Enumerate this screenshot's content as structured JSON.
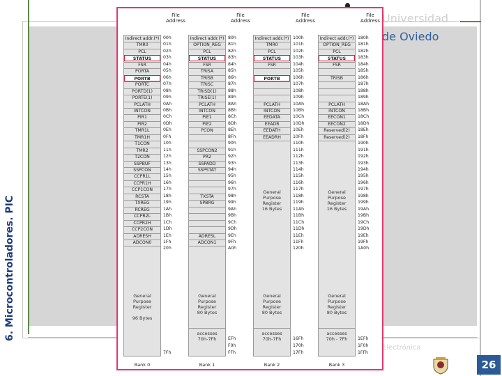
{
  "slide": {
    "side_title": "6. Microcontroladores. PIC",
    "university_line1": "Universidad",
    "university_line2": "de Oviedo",
    "footer_word": "Electrónica",
    "page_number": "26"
  },
  "diagram": {
    "header_label": "File\nAddress",
    "banks": [
      {
        "name": "Bank 0",
        "registers": [
          "Indirect addr.(*)",
          "TMR0",
          "PCL",
          "STATUS",
          "FSR",
          "PORTA",
          "PORTB",
          "PORTC",
          "PORTD(1)",
          "PORTE(1)",
          "PCLATH",
          "INTCON",
          "PIR1",
          "PIR2",
          "TMR1L",
          "TMR1H",
          "T1CON",
          "TMR2",
          "T2CON",
          "SSPBUF",
          "SSPCON",
          "CCPR1L",
          "CCPR1H",
          "CCP1CON",
          "RCSTA",
          "TXREG",
          "RCREG",
          "CCPR2L",
          "CCPR2H",
          "CCP2CON",
          "ADRESH",
          "ADCON0"
        ],
        "addresses": [
          "00h",
          "01h",
          "02h",
          "03h",
          "04h",
          "05h",
          "06h",
          "07h",
          "08h",
          "09h",
          "0Ah",
          "0Bh",
          "0Ch",
          "0Dh",
          "0Eh",
          "0Fh",
          "10h",
          "11h",
          "12h",
          "13h",
          "14h",
          "15h",
          "16h",
          "17h",
          "18h",
          "19h",
          "1Ah",
          "1Bh",
          "1Ch",
          "1Dh",
          "1Eh",
          "1Fh",
          "20h",
          "7Fh"
        ],
        "gp_text": "General\nPurpose\nRegister\n\n96 Bytes",
        "boxed": [
          "STATUS",
          "PORTB"
        ]
      },
      {
        "name": "Bank 1",
        "registers": [
          "Indirect addr.(*)",
          "OPTION_REG",
          "PCL",
          "STATUS",
          "FSR",
          "TRISA",
          "TRISB",
          "TRISC",
          "TRISD(1)",
          "TRISE(1)",
          "PCLATH",
          "INTCON",
          "PIE1",
          "PIE2",
          "PCON",
          "",
          "",
          "SSPCON2",
          "PR2",
          "SSPADD",
          "SSPSTAT",
          "",
          "",
          "",
          "TXSTA",
          "SPBRG",
          "",
          "",
          "",
          "",
          "ADRESL",
          "ADCON1"
        ],
        "addresses": [
          "80h",
          "81h",
          "82h",
          "83h",
          "84h",
          "85h",
          "86h",
          "87h",
          "88h",
          "89h",
          "8Ah",
          "8Bh",
          "8Ch",
          "8Dh",
          "8Eh",
          "8Fh",
          "90h",
          "91h",
          "92h",
          "93h",
          "94h",
          "95h",
          "96h",
          "97h",
          "98h",
          "99h",
          "9Ah",
          "9Bh",
          "9Ch",
          "9Dh",
          "9Eh",
          "9Fh",
          "A0h",
          "EFh",
          "F0h",
          "FFh"
        ],
        "gp_text": "General\nPurpose\nRegister\n80 Bytes",
        "access_text": "accesses\n70h-7Fh",
        "boxed": [
          "STATUS"
        ]
      },
      {
        "name": "Bank 2",
        "registers": [
          "Indirect addr.(*)",
          "TMR0",
          "PCL",
          "STATUS",
          "FSR",
          "",
          "PORTB",
          "",
          "",
          "",
          "PCLATH",
          "INTCON",
          "EEDATA",
          "EEADR",
          "EEDATH",
          "EEADRH"
        ],
        "addresses": [
          "100h",
          "101h",
          "102h",
          "103h",
          "104h",
          "105h",
          "106h",
          "107h",
          "108h",
          "109h",
          "10Ah",
          "10Bh",
          "10Ch",
          "10Dh",
          "10Eh",
          "10Fh",
          "110h",
          "111h",
          "112h",
          "113h",
          "114h",
          "115h",
          "116h",
          "117h",
          "118h",
          "119h",
          "11Ah",
          "11Bh",
          "11Ch",
          "11Dh",
          "11Eh",
          "11Fh",
          "120h",
          "16Fh",
          "170h",
          "17Fh"
        ],
        "gp_text_mid": "General\nPurpose\nRegister\n16 Bytes",
        "gp_text": "General\nPurpose\nRegister\n80 Bytes",
        "access_text": "accesses\n70h-7Fh",
        "boxed": [
          "STATUS",
          "PORTB"
        ]
      },
      {
        "name": "Bank 3",
        "registers": [
          "Indirect addr.(*)",
          "OPTION_REG",
          "PCL",
          "STATUS",
          "FSR",
          "",
          "TRISB",
          "",
          "",
          "",
          "PCLATH",
          "INTCON",
          "EECON1",
          "EECON2",
          "Reserved(2)",
          "Reserved(2)"
        ],
        "addresses": [
          "180h",
          "181h",
          "182h",
          "183h",
          "184h",
          "185h",
          "186h",
          "187h",
          "188h",
          "189h",
          "18Ah",
          "18Bh",
          "18Ch",
          "18Dh",
          "18Eh",
          "18Fh",
          "190h",
          "191h",
          "192h",
          "193h",
          "194h",
          "195h",
          "196h",
          "197h",
          "198h",
          "199h",
          "19Ah",
          "19Bh",
          "19Ch",
          "19Dh",
          "19Eh",
          "19Fh",
          "1A0h",
          "1EFh",
          "1F0h",
          "1FFh"
        ],
        "gp_text_mid": "General\nPurpose\nRegister\n16 Bytes",
        "gp_text": "General\nPurpose\nRegister\n80 Bytes",
        "access_text": "accesses\n70h - 7Fh",
        "boxed": [
          "STATUS"
        ]
      }
    ]
  },
  "colors": {
    "accent_green": "#5a8a4a",
    "highlight_red": "#d0243c",
    "frame_pink": "#e8356f",
    "page_badge": "#2c5a96"
  }
}
